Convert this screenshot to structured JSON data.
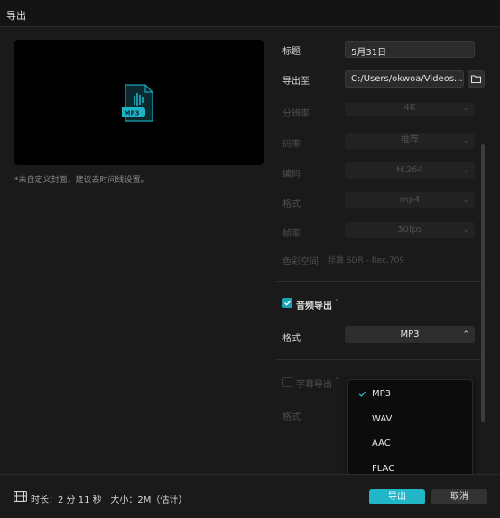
{
  "window": {
    "title": "导出"
  },
  "preview": {
    "file_badge": "MP3",
    "cover_hint": "*未自定义封面，建议去时间线设置。"
  },
  "settings": {
    "title_label": "标题",
    "title_value": "5月31日",
    "export_to_label": "导出至",
    "export_to_value": "C:/Users/okwoa/Videos...",
    "resolution_label": "分辨率",
    "resolution_value": "4K",
    "bitrate_label": "码率",
    "bitrate_value": "推荐",
    "codec_label": "编码",
    "codec_value": "H.264",
    "format_label": "格式",
    "format_value": "mp4",
    "framerate_label": "帧率",
    "framerate_value": "30fps",
    "colorspace_label": "色彩空间",
    "colorspace_value": "标准 SDR - Rec.709"
  },
  "audio": {
    "checkbox_label": "音频导出",
    "checked": true,
    "format_label": "格式",
    "format_value": "MP3",
    "options": [
      "MP3",
      "WAV",
      "AAC",
      "FLAC"
    ],
    "selected_option": "MP3"
  },
  "subtitle": {
    "checkbox_label": "字幕导出",
    "format_label": "格式"
  },
  "footer": {
    "duration_text": "时长：2 分 11 秒 | 大小：2M（估计）",
    "export_button": "导出",
    "cancel_button": "取消"
  },
  "colors": {
    "accent": "#22b6c9",
    "background": "#1a1a1a",
    "dropdown_bg": "#0c0c0c"
  }
}
